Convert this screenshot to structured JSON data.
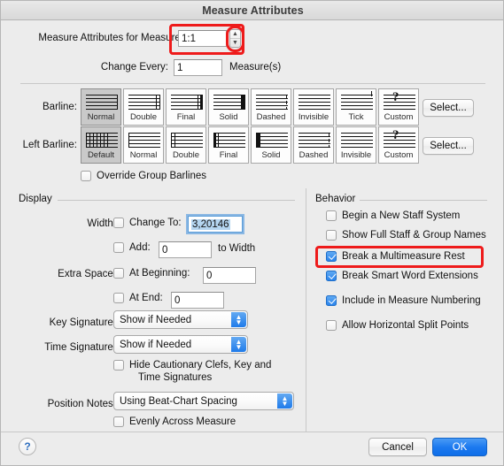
{
  "window": {
    "title": "Measure Attributes"
  },
  "top": {
    "measure_label": "Measure Attributes for Measure:",
    "measure_value": "1:1",
    "change_every_label": "Change Every:",
    "change_every_value": "1",
    "measures_suffix": "Measure(s)",
    "stepper_up_icon": "chevron-up-icon",
    "stepper_down_icon": "chevron-down-icon"
  },
  "barline": {
    "label": "Barline:",
    "select_label": "Select...",
    "selected_index": 0,
    "options": [
      {
        "name": "Normal",
        "style": "normal"
      },
      {
        "name": "Double",
        "style": "double"
      },
      {
        "name": "Final",
        "style": "final"
      },
      {
        "name": "Solid",
        "style": "solid"
      },
      {
        "name": "Dashed",
        "style": "dashed"
      },
      {
        "name": "Invisible",
        "style": "invisible"
      },
      {
        "name": "Tick",
        "style": "tick"
      },
      {
        "name": "Custom",
        "style": "custom"
      }
    ]
  },
  "left_barline": {
    "label": "Left Barline:",
    "select_label": "Select...",
    "selected_index": 0,
    "options": [
      {
        "name": "Default",
        "style": "default"
      },
      {
        "name": "Normal",
        "style": "lnormal"
      },
      {
        "name": "Double",
        "style": "ldouble"
      },
      {
        "name": "Final",
        "style": "lfinal"
      },
      {
        "name": "Solid",
        "style": "lsolid"
      },
      {
        "name": "Dashed",
        "style": "dashed"
      },
      {
        "name": "Invisible",
        "style": "invisible"
      },
      {
        "name": "Custom",
        "style": "custom"
      }
    ]
  },
  "override": {
    "label": "Override Group Barlines",
    "checked": false
  },
  "display": {
    "group_label": "Display",
    "width_label": "Width:",
    "change_to_label": "Change To:",
    "change_to_checked": false,
    "change_to_value": "3,20146",
    "add_label": "Add:",
    "add_checked": false,
    "add_value": "0",
    "to_width_label": "to Width",
    "extra_space_label": "Extra Space:",
    "at_beginning_label": "At Beginning:",
    "at_beginning_checked": false,
    "at_beginning_value": "0",
    "at_end_label": "At End:",
    "at_end_checked": false,
    "at_end_value": "0",
    "key_sig_label": "Key Signature:",
    "key_sig_value": "Show if Needed",
    "time_sig_label": "Time Signature:",
    "time_sig_value": "Show if Needed",
    "hide_cautionary_label_1": "Hide Cautionary Clefs, Key and",
    "hide_cautionary_label_2": "Time Signatures",
    "hide_cautionary_checked": false,
    "position_notes_label": "Position Notes:",
    "position_notes_value": "Using Beat-Chart Spacing",
    "evenly_label": "Evenly Across Measure",
    "evenly_checked": false
  },
  "behavior": {
    "group_label": "Behavior",
    "items": [
      {
        "label": "Begin a New Staff System",
        "checked": false,
        "highlighted": false
      },
      {
        "label": "Show Full Staff & Group Names",
        "checked": false,
        "highlighted": false
      },
      {
        "label": "Break a Multimeasure Rest",
        "checked": true,
        "highlighted": true
      },
      {
        "label": "Break Smart Word Extensions",
        "checked": true,
        "highlighted": false
      },
      {
        "label": "Include in Measure Numbering",
        "checked": true,
        "highlighted": false
      },
      {
        "label": "Allow Horizontal Split Points",
        "checked": false,
        "highlighted": false
      }
    ]
  },
  "footer": {
    "help_label": "?",
    "help_icon": "question-mark-icon",
    "cancel_label": "Cancel",
    "ok_label": "OK"
  },
  "annotation": {
    "color": "#ee1b1b"
  }
}
